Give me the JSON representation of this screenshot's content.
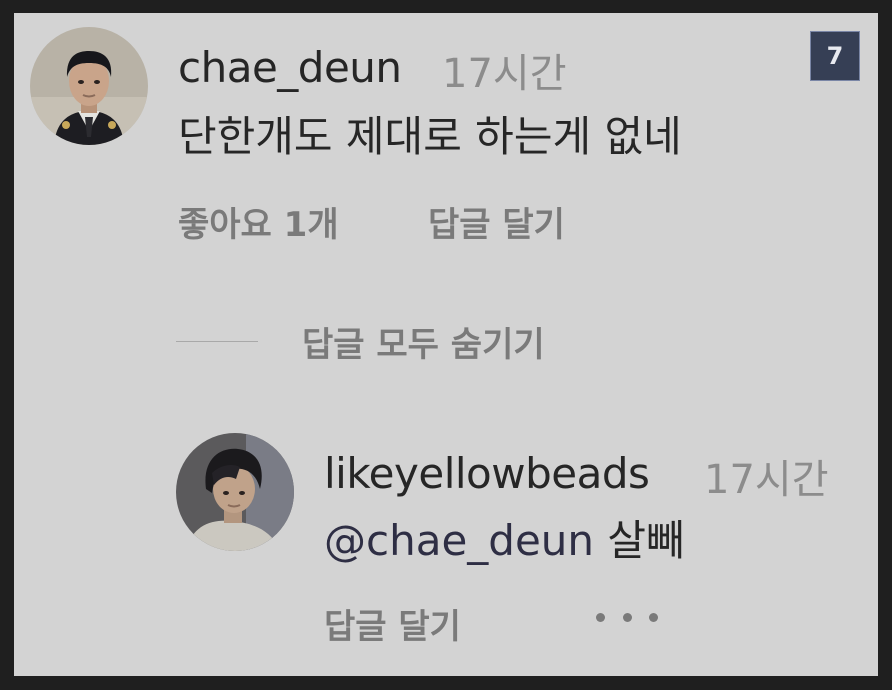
{
  "badge": {
    "number": "7"
  },
  "comment": {
    "username": "chae_deun",
    "time": "17시간",
    "text": "단한개도 제대로 하는게 없네",
    "likes_label": "좋아요 1개",
    "reply_label": "답글 달기"
  },
  "replies_toggle": {
    "label": "답글 모두 숨기기"
  },
  "reply": {
    "username": "likeyellowbeads",
    "time": "17시간",
    "mention": "@chae_deun",
    "text": "살빼",
    "reply_label": "답글 달기"
  },
  "colors": {
    "background": "#d3d3d3",
    "frame": "#1f1f1f",
    "badge": "#363f55"
  },
  "icons": {
    "more": "more-dots-icon"
  }
}
